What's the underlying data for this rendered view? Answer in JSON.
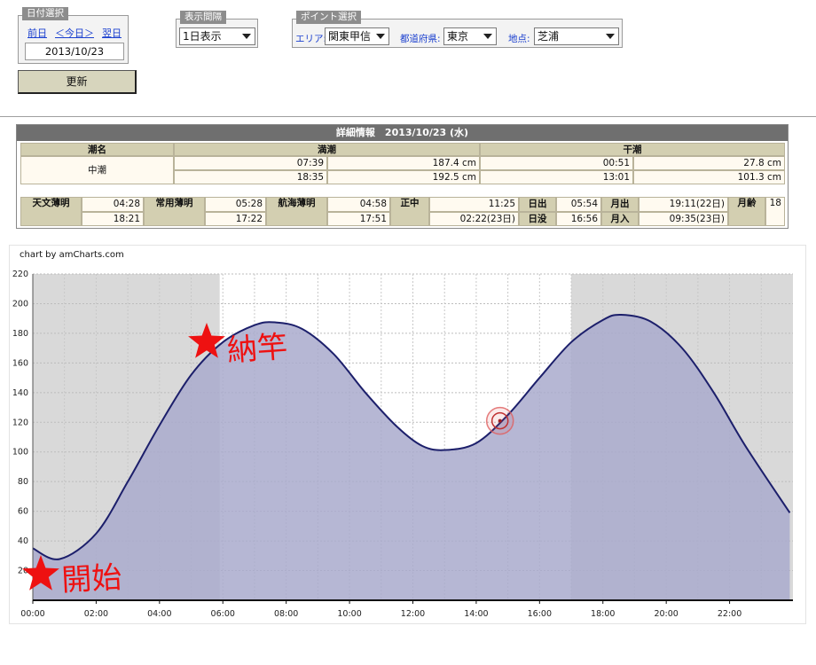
{
  "date_select": {
    "tab": "日付選択",
    "prev": "前日",
    "today": "＜今日＞",
    "next": "翌日",
    "date": "2013/10/23"
  },
  "interval": {
    "tab": "表示間隔",
    "selected": "1日表示"
  },
  "point": {
    "tab": "ポイント選択",
    "area_label": "エリア:",
    "area": "関東甲信",
    "pref_label": "都道府県:",
    "pref": "東京",
    "spot_label": "地点:",
    "spot": "芝浦"
  },
  "update_label": "更新",
  "detail": {
    "title": "詳細情報　2013/10/23 (水)",
    "tide_name_header": "潮名",
    "high_header": "満潮",
    "low_header": "干潮",
    "tide_name": "中潮",
    "high": [
      {
        "time": "07:39",
        "level": "187.4 cm"
      },
      {
        "time": "18:35",
        "level": "192.5 cm"
      }
    ],
    "low": [
      {
        "time": "00:51",
        "level": "27.8 cm"
      },
      {
        "time": "13:01",
        "level": "101.3 cm"
      }
    ],
    "astro": {
      "astronomical_twilight_label": "天文薄明",
      "astronomical_twilight": [
        "04:28",
        "18:21"
      ],
      "civil_twilight_label": "常用薄明",
      "civil_twilight": [
        "05:28",
        "17:22"
      ],
      "nautical_twilight_label": "航海薄明",
      "nautical_twilight": [
        "04:58",
        "17:51"
      ],
      "noon_label": "正中",
      "noon": [
        "11:25",
        "02:22(23日)"
      ],
      "sunrise_label": "日出",
      "sunrise": "05:54",
      "sunset_label": "日没",
      "sunset": "16:56",
      "moonrise_label": "月出",
      "moonrise": "19:11(22日)",
      "moonset_label": "月入",
      "moonset": "09:35(23日)",
      "moon_age_label": "月齢",
      "moon_age": "18"
    }
  },
  "chart_credit": "chart by amCharts.com",
  "annotations": {
    "start": "開始",
    "end": "納竿"
  },
  "colors": {
    "area_fill": "#a9aacc",
    "line": "#1c1f6b",
    "night": "#d9d9d9",
    "annotation": "#ee1111"
  },
  "chart_data": {
    "type": "area",
    "x_unit": "hour",
    "x_ticks": [
      "00:00",
      "02:00",
      "04:00",
      "06:00",
      "08:00",
      "10:00",
      "12:00",
      "14:00",
      "16:00",
      "18:00",
      "20:00",
      "22:00"
    ],
    "y_ticks": [
      20,
      40,
      60,
      80,
      100,
      120,
      140,
      160,
      180,
      200,
      220
    ],
    "ylim": [
      0,
      220
    ],
    "xlim": [
      0,
      24
    ],
    "night_bands": [
      [
        0,
        5.9
      ],
      [
        17.0,
        24
      ]
    ],
    "series": [
      {
        "points": [
          [
            0,
            35
          ],
          [
            0.85,
            27.8
          ],
          [
            2,
            45
          ],
          [
            3,
            80
          ],
          [
            4,
            118
          ],
          [
            5,
            152
          ],
          [
            6,
            174
          ],
          [
            7,
            185.5
          ],
          [
            7.65,
            187.4
          ],
          [
            8.5,
            183
          ],
          [
            9.5,
            166
          ],
          [
            10.5,
            140
          ],
          [
            11.5,
            117
          ],
          [
            12.3,
            104
          ],
          [
            13.02,
            101.3
          ],
          [
            14,
            106
          ],
          [
            15,
            125
          ],
          [
            16,
            150
          ],
          [
            17,
            174
          ],
          [
            18,
            189
          ],
          [
            18.58,
            192.5
          ],
          [
            19.5,
            188
          ],
          [
            20.5,
            170
          ],
          [
            21.5,
            140
          ],
          [
            22.5,
            104
          ],
          [
            23.9,
            59
          ]
        ]
      }
    ],
    "marker": {
      "x": 14.75,
      "y": 121
    },
    "ylabel": "",
    "xlabel": "",
    "title": ""
  }
}
